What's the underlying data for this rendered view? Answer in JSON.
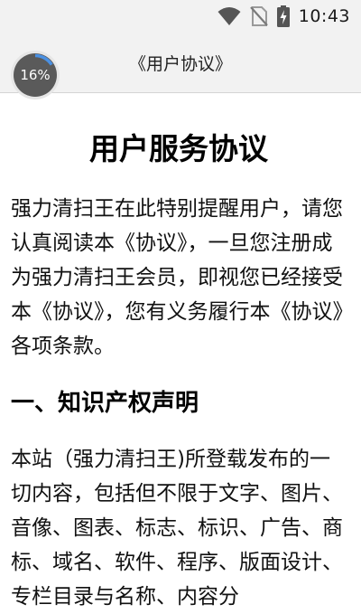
{
  "status_bar": {
    "time": "10:43",
    "icons": [
      "wifi-icon",
      "no-sim-icon",
      "battery-charging-icon"
    ]
  },
  "app_bar": {
    "title": "《用户协议》",
    "progress_label": "16%",
    "progress_fraction": 0.16
  },
  "document": {
    "title": "用户服务协议",
    "intro": "强力清扫王在此特别提醒用户，请您认真阅读本《协议》，一旦您注册成为强力清扫王会员，即视您已经接受本《协议》，您有义务履行本《协议》各项条款。",
    "section1_heading": "一、知识产权声明",
    "section1_body": "本站（强力清扫王)所登载发布的一切内容，包括但不限于文字、图片、音像、图表、标志、标识、广告、商标、域名、软件、程序、版面设计、专栏目录与名称、内容分"
  },
  "colors": {
    "status_bar_bg": "#f2f2f2",
    "progress_track": "#5a5a5a",
    "progress_fill": "#4a90e2"
  }
}
